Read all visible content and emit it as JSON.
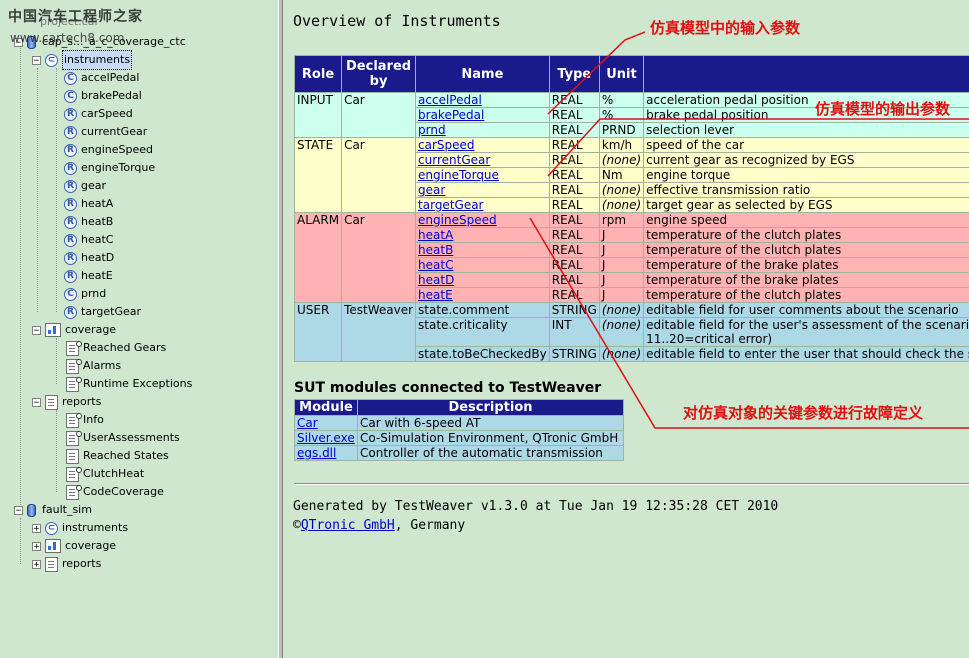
{
  "watermark": {
    "site": "中国汽车工程师之家",
    "url": "www.cartech8.com"
  },
  "tree": {
    "partial_top": "project.car",
    "root1": "cap_s..._a_c_coverage_ctc",
    "instruments": "instruments",
    "items": [
      {
        "icon": "C",
        "label": "accelPedal"
      },
      {
        "icon": "C",
        "label": "brakePedal"
      },
      {
        "icon": "R",
        "label": "carSpeed"
      },
      {
        "icon": "R",
        "label": "currentGear"
      },
      {
        "icon": "R",
        "label": "engineSpeed"
      },
      {
        "icon": "R",
        "label": "engineTorque"
      },
      {
        "icon": "R",
        "label": "gear"
      },
      {
        "icon": "R",
        "label": "heatA"
      },
      {
        "icon": "R",
        "label": "heatB"
      },
      {
        "icon": "R",
        "label": "heatC"
      },
      {
        "icon": "R",
        "label": "heatD"
      },
      {
        "icon": "R",
        "label": "heatE"
      },
      {
        "icon": "C",
        "label": "prnd"
      },
      {
        "icon": "R",
        "label": "targetGear"
      }
    ],
    "coverage": "coverage",
    "coverage_items": [
      "Reached Gears",
      "Alarms",
      "Runtime Exceptions"
    ],
    "reports": "reports",
    "report_items": [
      "Info",
      "UserAssessments",
      "Reached States",
      "ClutchHeat",
      "CodeCoverage"
    ],
    "root2": "fault_sim",
    "root2_items": [
      "instruments",
      "coverage",
      "reports"
    ]
  },
  "overview": {
    "title": "Overview of Instruments",
    "headers": {
      "role": "Role",
      "declared": "Declared by",
      "name": "Name",
      "type": "Type",
      "unit": "Unit"
    },
    "groups": [
      {
        "role": "INPUT",
        "declared": "Car",
        "cls": "r-input",
        "rows": [
          {
            "name": "accelPedal",
            "link": true,
            "type": "REAL",
            "unit": "%",
            "desc": "acceleration pedal position"
          },
          {
            "name": "brakePedal",
            "link": true,
            "type": "REAL",
            "unit": "%",
            "desc": "brake pedal position"
          },
          {
            "name": "prnd",
            "link": true,
            "type": "REAL",
            "unit": "PRND",
            "desc": "selection lever"
          }
        ]
      },
      {
        "role": "STATE",
        "declared": "Car",
        "cls": "r-state",
        "rows": [
          {
            "name": "carSpeed",
            "link": true,
            "type": "REAL",
            "unit": "km/h",
            "desc": "speed of the car"
          },
          {
            "name": "currentGear",
            "link": true,
            "type": "REAL",
            "unit": "(none)",
            "desc": "current gear as recognized by EGS"
          },
          {
            "name": "engineTorque",
            "link": true,
            "type": "REAL",
            "unit": "Nm",
            "desc": "engine torque"
          },
          {
            "name": "gear",
            "link": true,
            "type": "REAL",
            "unit": "(none)",
            "desc": "effective transmission ratio"
          },
          {
            "name": "targetGear",
            "link": true,
            "type": "REAL",
            "unit": "(none)",
            "desc": "target gear as selected by EGS"
          }
        ]
      },
      {
        "role": "ALARM",
        "declared": "Car",
        "cls": "r-alarm",
        "rows": [
          {
            "name": "engineSpeed",
            "link": true,
            "type": "REAL",
            "unit": "rpm",
            "desc": "engine speed"
          },
          {
            "name": "heatA",
            "link": true,
            "type": "REAL",
            "unit": "J",
            "desc": "temperature of the clutch plates"
          },
          {
            "name": "heatB",
            "link": true,
            "type": "REAL",
            "unit": "J",
            "desc": "temperature of the clutch plates"
          },
          {
            "name": "heatC",
            "link": true,
            "type": "REAL",
            "unit": "J",
            "desc": "temperature of the brake plates"
          },
          {
            "name": "heatD",
            "link": true,
            "type": "REAL",
            "unit": "J",
            "desc": "temperature of the brake plates"
          },
          {
            "name": "heatE",
            "link": true,
            "type": "REAL",
            "unit": "J",
            "desc": "temperature of the clutch plates"
          }
        ]
      },
      {
        "role": "USER",
        "declared": "TestWeaver",
        "cls": "r-user",
        "rows": [
          {
            "name": "state.comment",
            "link": false,
            "type": "STRING",
            "unit": "(none)",
            "desc": "editable field for user comments about the scenario"
          },
          {
            "name": "state.criticality",
            "link": false,
            "type": "INT",
            "unit": "(none)",
            "desc": "editable field for the user's assessment of the scenario",
            "desc2": "11..20=critical error)"
          },
          {
            "name": "state.toBeCheckedBy",
            "link": false,
            "type": "STRING",
            "unit": "(none)",
            "desc": "editable field to enter the user that should check the scenario"
          }
        ]
      }
    ]
  },
  "sut": {
    "title": "SUT modules connected to TestWeaver",
    "headers": {
      "module": "Module",
      "description": "Description"
    },
    "rows": [
      {
        "module": "Car",
        "description": "Car with 6-speed AT"
      },
      {
        "module": "Silver.exe",
        "description": "Co-Simulation Environment, QTronic GmbH"
      },
      {
        "module": "egs.dll",
        "description": "Controller of the automatic transmission"
      }
    ]
  },
  "footer": {
    "generated": "Generated by TestWeaver v1.3.0 at Tue Jan 19 12:35:28 CET 2010",
    "copyright": "©",
    "company": "QTronic GmbH",
    "country": ", Germany"
  },
  "annotations": {
    "input_params": "仿真模型中的输入参数",
    "output_params": "仿真模型的输出参数",
    "fault_def": "对仿真对象的关键参数进行故障定义"
  },
  "colors": {
    "annotation": "#e01010",
    "header_bg": "#1a1a8c",
    "page_bg": "#cfe6cf"
  }
}
